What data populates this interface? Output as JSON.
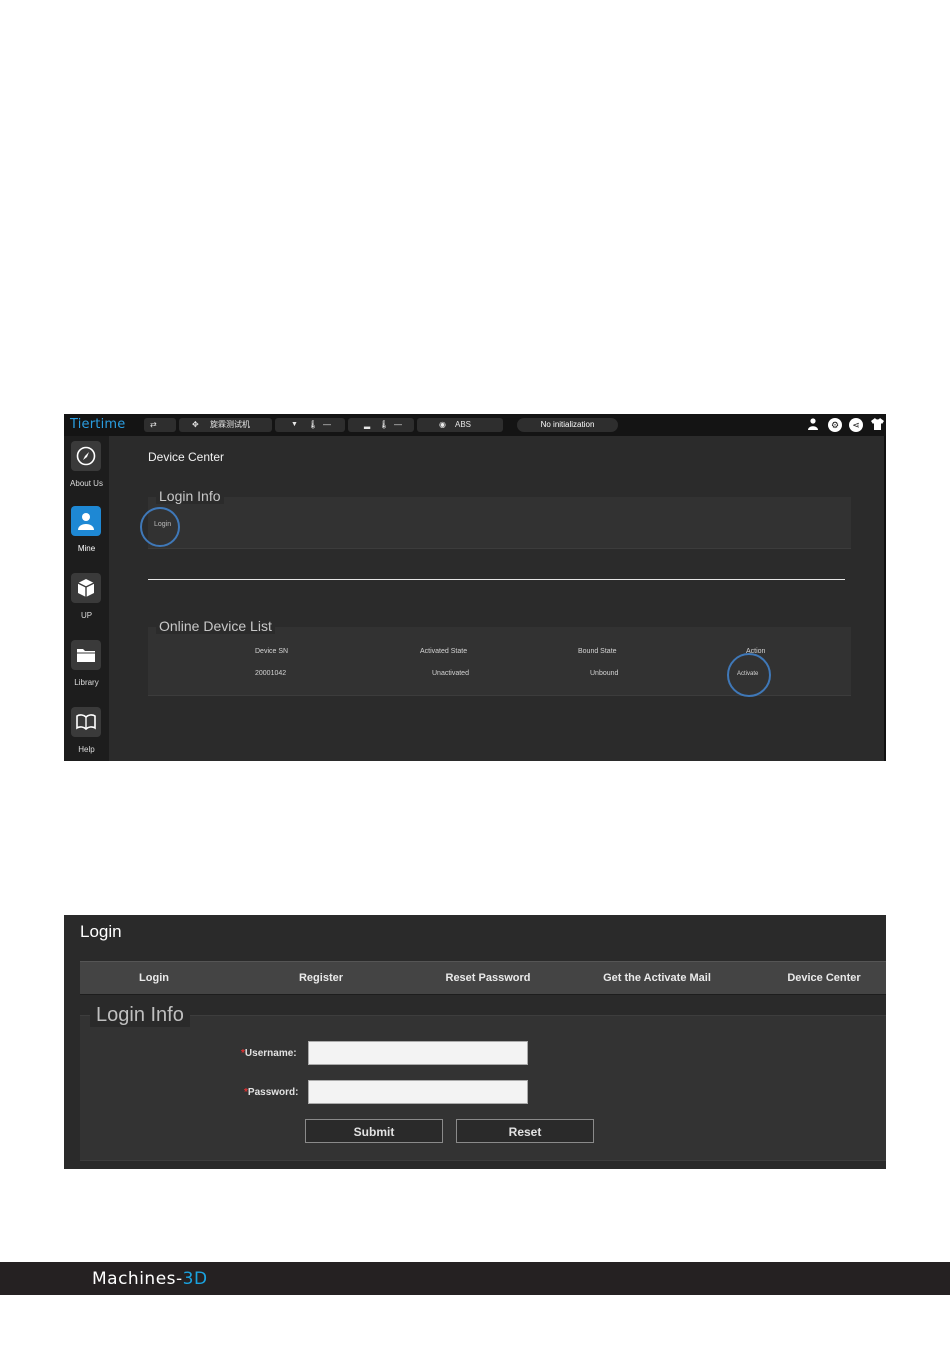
{
  "app": {
    "logo": "Tiertime",
    "topbar": {
      "printer_name": "旋霖测试机",
      "nozzle_temp": "—",
      "bed_temp": "—",
      "material": "ABS",
      "status": "No initialization"
    },
    "sidebar": [
      {
        "label": "About Us",
        "icon": "compass-icon"
      },
      {
        "label": "Mine",
        "icon": "user-icon"
      },
      {
        "label": "UP",
        "icon": "cube-icon"
      },
      {
        "label": "Library",
        "icon": "folder-icon"
      },
      {
        "label": "Help",
        "icon": "book-icon"
      }
    ],
    "device_center": {
      "title": "Device Center",
      "login_info_legend": "Login Info",
      "login_link": "Login",
      "device_list_legend": "Online Device List",
      "columns": [
        "Device SN",
        "Activated State",
        "Bound State",
        "Action"
      ],
      "rows": [
        {
          "sn": "20001042",
          "activated": "Unactivated",
          "bound": "Unbound",
          "action": "Activate"
        }
      ]
    },
    "highlight_color": "#3f78b8",
    "accent_color": "#1e88d4"
  },
  "login_window": {
    "title": "Login",
    "tabs": [
      "Login",
      "Register",
      "Reset Password",
      "Get the Activate Mail",
      "Device Center"
    ],
    "legend": "Login Info",
    "required_mark": "*",
    "username_label": "Username:",
    "password_label": "Password:",
    "username_value": "",
    "password_value": "",
    "submit_label": "Submit",
    "reset_label": "Reset"
  },
  "footer": {
    "brand_main": "Machines-",
    "brand_accent": "3D"
  }
}
